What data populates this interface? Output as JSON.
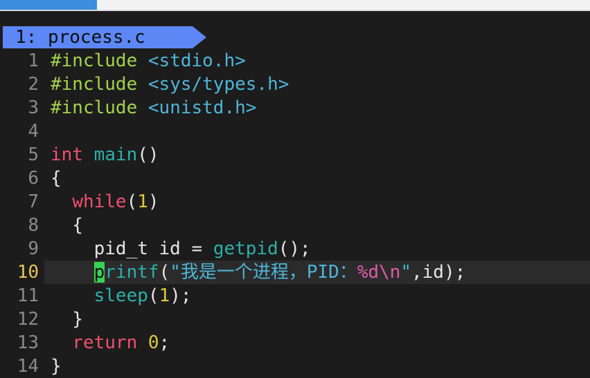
{
  "tabline": {
    "active_tab": "1: process.c"
  },
  "code_lines": [
    {
      "num": "1",
      "segments": [
        {
          "cls": "pp",
          "text": "#include"
        },
        {
          "cls": "",
          "text": " "
        },
        {
          "cls": "hdr",
          "text": "<stdio.h>"
        }
      ]
    },
    {
      "num": "2",
      "segments": [
        {
          "cls": "pp",
          "text": "#include"
        },
        {
          "cls": "",
          "text": " "
        },
        {
          "cls": "hdr",
          "text": "<sys/types.h>"
        }
      ]
    },
    {
      "num": "3",
      "segments": [
        {
          "cls": "pp",
          "text": "#include"
        },
        {
          "cls": "",
          "text": " "
        },
        {
          "cls": "hdr",
          "text": "<unistd.h>"
        }
      ]
    },
    {
      "num": "4",
      "segments": []
    },
    {
      "num": "5",
      "segments": [
        {
          "cls": "kw",
          "text": "int"
        },
        {
          "cls": "",
          "text": " "
        },
        {
          "cls": "fn",
          "text": "main"
        },
        {
          "cls": "",
          "text": "()"
        }
      ]
    },
    {
      "num": "6",
      "segments": [
        {
          "cls": "",
          "text": "{"
        }
      ]
    },
    {
      "num": "7",
      "segments": [
        {
          "cls": "",
          "text": "  "
        },
        {
          "cls": "kw",
          "text": "while"
        },
        {
          "cls": "",
          "text": "("
        },
        {
          "cls": "num",
          "text": "1"
        },
        {
          "cls": "",
          "text": ")"
        }
      ]
    },
    {
      "num": "8",
      "segments": [
        {
          "cls": "",
          "text": "  {"
        }
      ]
    },
    {
      "num": "9",
      "segments": [
        {
          "cls": "",
          "text": "    pid_t id = "
        },
        {
          "cls": "fn",
          "text": "getpid"
        },
        {
          "cls": "",
          "text": "();"
        }
      ]
    },
    {
      "num": "10",
      "current": true,
      "segments": [
        {
          "cls": "",
          "text": "    "
        },
        {
          "cls": "cursor",
          "text": "p"
        },
        {
          "cls": "fn",
          "text": "rintf"
        },
        {
          "cls": "",
          "text": "("
        },
        {
          "cls": "str",
          "text": "\"我是一个进程，PID："
        },
        {
          "cls": "fmt",
          "text": "%d\\n"
        },
        {
          "cls": "str",
          "text": "\""
        },
        {
          "cls": "",
          "text": ",id);"
        }
      ]
    },
    {
      "num": "11",
      "segments": [
        {
          "cls": "",
          "text": "    "
        },
        {
          "cls": "fn",
          "text": "sleep"
        },
        {
          "cls": "",
          "text": "("
        },
        {
          "cls": "num",
          "text": "1"
        },
        {
          "cls": "",
          "text": ");"
        }
      ]
    },
    {
      "num": "12",
      "segments": [
        {
          "cls": "",
          "text": "  }"
        }
      ]
    },
    {
      "num": "13",
      "segments": [
        {
          "cls": "",
          "text": "  "
        },
        {
          "cls": "kw",
          "text": "return"
        },
        {
          "cls": "",
          "text": " "
        },
        {
          "cls": "num",
          "text": "0"
        },
        {
          "cls": "",
          "text": ";"
        }
      ]
    },
    {
      "num": "14",
      "segments": [
        {
          "cls": "",
          "text": "}"
        }
      ]
    }
  ],
  "colors": {
    "background": "#1c1c1c",
    "tab_active": "#5c87f5",
    "preprocessor": "#a3d24c",
    "header": "#4fb5d8",
    "keyword": "#f0506e",
    "function": "#2bb0ab",
    "number": "#e0c840",
    "format": "#e05caa",
    "cursor": "#39d353",
    "current_line_number": "#e8c45a"
  },
  "icons": {
    "tab_arrow": "powerline-arrow-icon"
  }
}
